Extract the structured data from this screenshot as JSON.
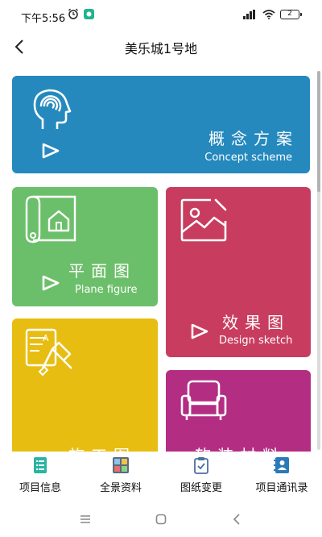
{
  "status_bar": {
    "time": "下午5:56",
    "battery": "2"
  },
  "nav": {
    "title": "美乐城1号地"
  },
  "tiles": {
    "concept": {
      "title": "概念方案",
      "subtitle": "Concept scheme",
      "color": "#2589bd"
    },
    "plane": {
      "title": "平面图",
      "subtitle": "Plane figure",
      "color": "#6cbf6a"
    },
    "design": {
      "title": "效果图",
      "subtitle": "Design sketch",
      "color": "#c83d5f"
    },
    "build": {
      "title": "施工图",
      "color": "#e8bd12"
    },
    "soft": {
      "title": "软装材料",
      "color": "#b32d82"
    }
  },
  "tabbar": {
    "items": [
      {
        "label": "项目信息",
        "icon": "document-list-icon"
      },
      {
        "label": "全景资料",
        "icon": "panorama-icon"
      },
      {
        "label": "图纸变更",
        "icon": "clipboard-check-icon"
      },
      {
        "label": "项目通讯录",
        "icon": "contacts-icon"
      }
    ]
  }
}
